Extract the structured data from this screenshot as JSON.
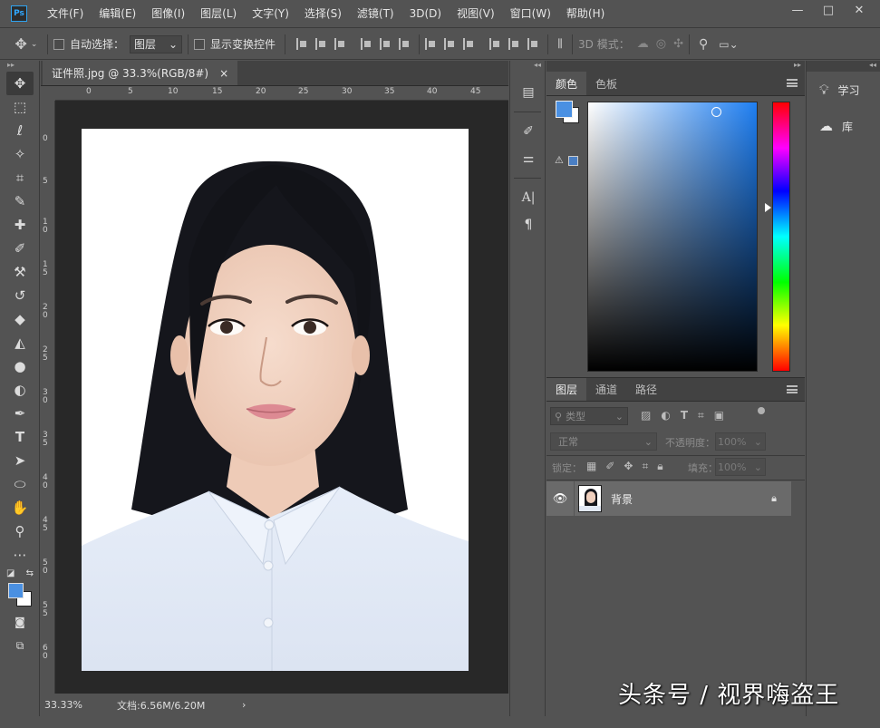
{
  "app": {
    "logo": "Ps"
  },
  "menu": [
    "文件(F)",
    "编辑(E)",
    "图像(I)",
    "图层(L)",
    "文字(Y)",
    "选择(S)",
    "滤镜(T)",
    "3D(D)",
    "视图(V)",
    "窗口(W)",
    "帮助(H)"
  ],
  "window_controls": {
    "minimize": "—",
    "maximize": "□",
    "close": "✕"
  },
  "options": {
    "auto_select_label": "自动选择：",
    "auto_select_value": "图层",
    "transform_label": "显示变换控件",
    "mode_label": "3D 模式："
  },
  "document": {
    "tab_title": "证件照.jpg @ 33.3%(RGB/8#)",
    "tab_close": "×",
    "zoom": "33.33%",
    "doc_size": "文档:6.56M/6.20M",
    "status_arrow": "›"
  },
  "ruler_h": [
    "0",
    "5",
    "10",
    "15",
    "20",
    "25",
    "30",
    "35",
    "40",
    "45"
  ],
  "ruler_v": [
    "0",
    "5",
    "1 0",
    "1 5",
    "2 0",
    "2 5",
    "3 0",
    "3 5",
    "4 0",
    "4 5",
    "5 0",
    "5 5",
    "6 0"
  ],
  "color_panel": {
    "tabs": [
      "颜色",
      "色板"
    ],
    "foreground": "#4a90e2",
    "background": "#ffffff",
    "picker_hue": "#1f7ff2"
  },
  "layers_panel": {
    "tabs": [
      "图层",
      "通道",
      "路径"
    ],
    "filter_kind": "类型",
    "blend_mode": "正常",
    "opacity_label": "不透明度：",
    "opacity_value": "100%",
    "lock_label": "锁定：",
    "fill_label": "填充：",
    "fill_value": "100%",
    "layers": [
      {
        "name": "背景",
        "visible": true,
        "locked": true
      }
    ]
  },
  "side_panels": [
    {
      "label": "学习",
      "icon": "lightbulb-icon"
    },
    {
      "label": "库",
      "icon": "cc-libraries-icon"
    }
  ],
  "watermark": "头条号 / 视界嗨盗王",
  "colors": {
    "accent": "#31a8ff",
    "bg": "#535353",
    "dark": "#282828"
  }
}
